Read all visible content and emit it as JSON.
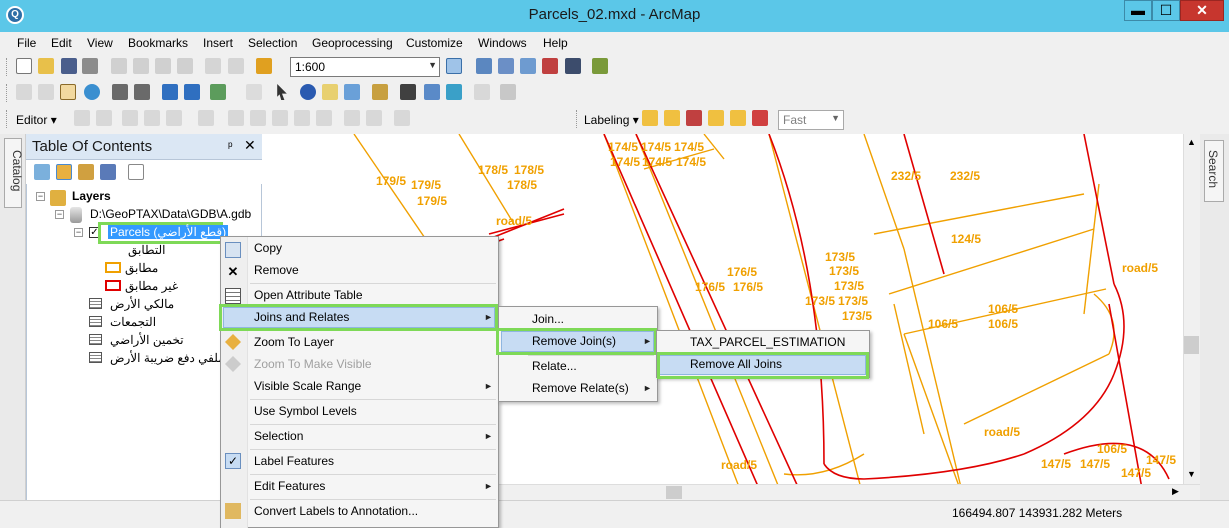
{
  "window": {
    "title": "Parcels_02.mxd - ArcMap",
    "minimize": "▬",
    "maximize": "☐",
    "close": "✕",
    "app_icon": "Q"
  },
  "menubar": {
    "items": [
      "File",
      "Edit",
      "View",
      "Bookmarks",
      "Insert",
      "Selection",
      "Geoprocessing",
      "Customize",
      "Windows",
      "Help"
    ]
  },
  "toolbar": {
    "scale_value": "1:600",
    "editor_label": "Editor",
    "labeling_label": "Labeling",
    "label_quality": "Fast"
  },
  "catalog_tab": "Catalog",
  "search_tab": "Search",
  "toc": {
    "title": "Table Of Contents",
    "pin": "ᵖ",
    "close": "✕",
    "root": "Layers",
    "gdb_path": "D:\\GeoPTAX\\Data\\GDB\\A.gdb",
    "selected_layer": "Parcels (قطع الأراضي)",
    "legend_heading": "التطابق",
    "legend_items": [
      {
        "label": "مطابق",
        "color": "#f0a000"
      },
      {
        "label": "غير مطابق",
        "color": "#e00000"
      }
    ],
    "tables": [
      "مالكي الأرض",
      "التجمعات",
      "تخمين الأراضي",
      "ملفي دفع ضريبة الأرض"
    ]
  },
  "context_menu": {
    "copy": "Copy",
    "remove": "Remove",
    "open_attribute_table": "Open Attribute Table",
    "joins_and_relates": "Joins and Relates",
    "zoom_to_layer": "Zoom To Layer",
    "zoom_to_make_visible": "Zoom To Make Visible",
    "visible_scale_range": "Visible Scale Range",
    "use_symbol_levels": "Use Symbol Levels",
    "selection": "Selection",
    "label_features": "Label Features",
    "edit_features": "Edit Features",
    "convert_labels": "Convert Labels to Annotation...",
    "arrow": "►",
    "check": "✓",
    "x_mark": "✕"
  },
  "joins_submenu": {
    "join": "Join...",
    "remove_joins": "Remove Join(s)",
    "relate": "Relate...",
    "remove_relates": "Remove Relate(s)"
  },
  "remove_joins_submenu": {
    "tax_parcel": "TAX_PARCEL_ESTIMATION",
    "remove_all": "Remove All Joins"
  },
  "map": {
    "parcel_labels": [
      "179/5",
      "179/5",
      "179/5",
      "178/5",
      "178/5",
      "178/5",
      "174/5",
      "174/5",
      "174/5",
      "174/5",
      "174/5",
      "174/5",
      "232/5",
      "232/5",
      "124/5",
      "176/5",
      "176/5",
      "176/5",
      "173/5",
      "173/5",
      "173/5",
      "173/5",
      "173/5",
      "173/5",
      "106/5",
      "106/5",
      "106/5",
      "106/5",
      "147/5",
      "147/5",
      "147/5",
      "147/5"
    ],
    "road_labels": [
      "road/5",
      "road/5",
      "road/5",
      "road/5"
    ],
    "parcel_color": "#f0a000",
    "road_color": "#e00000"
  },
  "status": {
    "coordinates": "166494.807  143931.282 Meters"
  }
}
